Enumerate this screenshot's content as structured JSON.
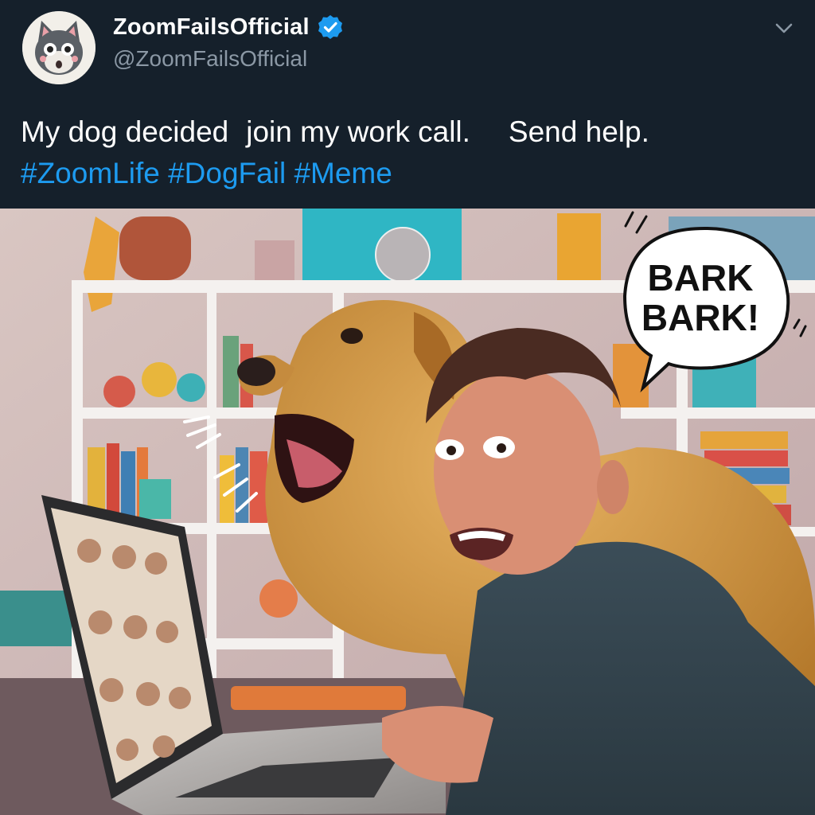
{
  "account": {
    "display_name": "ZoomFailsOfficial",
    "handle": "@ZoomFailsOfficial",
    "verified": true,
    "avatar_icon": "cartoon-cat-avatar"
  },
  "tweet": {
    "text_part1": "My dog decided",
    "text_part2": "join my work call.",
    "text_part3": "Send help.",
    "hashtags": [
      "#ZoomLife",
      "#DogFail",
      "#Meme"
    ]
  },
  "media": {
    "speech_bubble_line1": "BARK",
    "speech_bubble_line2": "BARK!"
  },
  "colors": {
    "background": "#15202b",
    "text": "#ffffff",
    "muted": "#8b98a5",
    "link": "#1d9bf0",
    "verified_badge": "#1d9bf0"
  },
  "icons": [
    "verified-badge-icon",
    "chevron-down-icon"
  ]
}
